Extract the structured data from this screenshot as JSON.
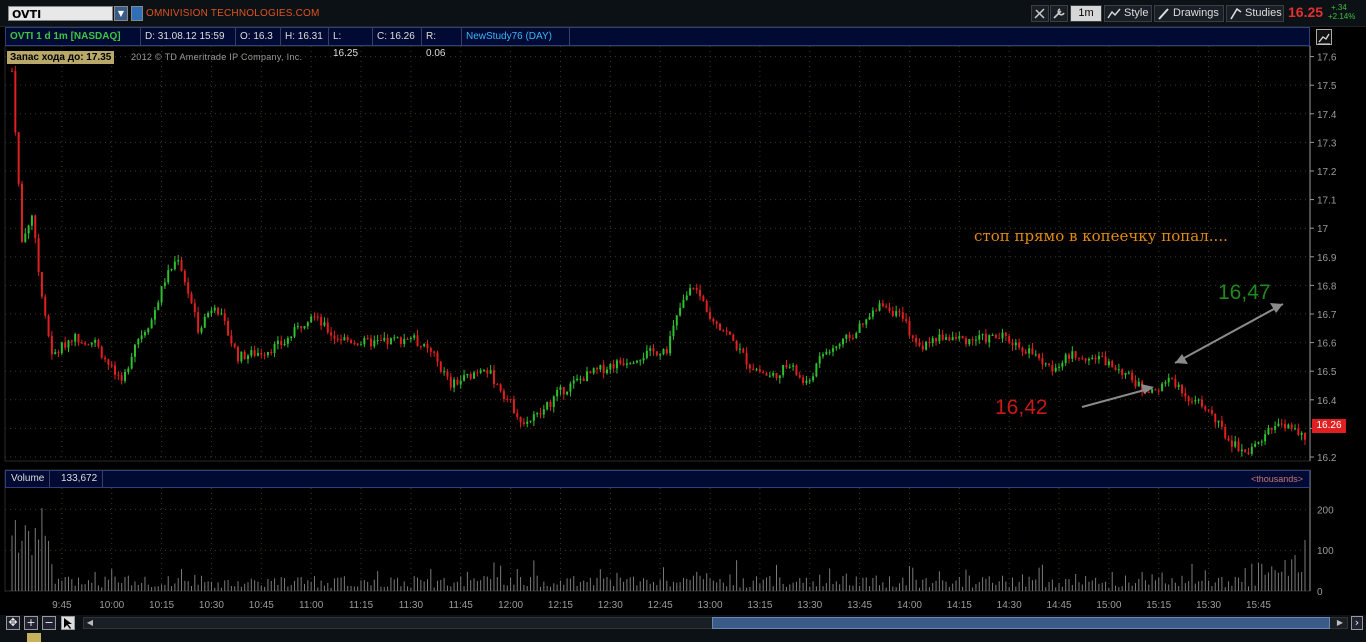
{
  "toolbar": {
    "symbol": "OVTI",
    "company": "OMNIVISION TECHNOLOGIES.COM",
    "aggregation": "1m",
    "style_label": "Style",
    "drawings_label": "Drawings",
    "studies_label": "Studies",
    "last_price": "16.25",
    "change_abs": "+.34",
    "change_pct": "+2.14%"
  },
  "info": {
    "title": "OVTI 1 d 1m [NASDAQ]",
    "date": "D: 31.08.12 15:59",
    "open": "O: 16.3",
    "high": "H: 16.31",
    "low": "L: 16.25",
    "close": "C: 16.26",
    "range": "R: 0.06",
    "study": "NewStudy76 (DAY)"
  },
  "badge": "Запас хода до: 17.35",
  "copyright": "2012 © TD Ameritrade IP Company, Inc.",
  "annotations": {
    "note": "стоп прямо в копеечку попал....",
    "green_price": "16,47",
    "red_price": "16,42"
  },
  "current_price_tag": "16.26",
  "volume": {
    "label": "Volume",
    "value": "133,672",
    "units": "<thousands>"
  },
  "colors": {
    "up": "#2fbf2f",
    "down": "#e02020",
    "grid": "#3a3a22",
    "axis": "#9a9a9a",
    "volume": "#7a7a7a"
  },
  "chart_data": {
    "type": "candlestick",
    "price_axis": {
      "ticks": [
        16.2,
        16.3,
        16.4,
        16.5,
        16.6,
        16.7,
        16.8,
        16.9,
        17,
        17.1,
        17.2,
        17.3,
        17.4,
        17.5,
        17.6
      ],
      "ylim": [
        16.18,
        17.63
      ]
    },
    "volume_axis": {
      "ticks": [
        0,
        100,
        200
      ]
    },
    "time_ticks": [
      "9:45",
      "10:00",
      "10:15",
      "10:30",
      "10:45",
      "11:00",
      "11:15",
      "11:30",
      "11:45",
      "12:00",
      "12:15",
      "12:30",
      "12:45",
      "13:00",
      "13:15",
      "13:30",
      "13:45",
      "14:00",
      "14:15",
      "14:30",
      "14:45",
      "15:00",
      "15:15",
      "15:30",
      "15:45"
    ],
    "price_path": [
      {
        "t": "9:30",
        "p": 17.55
      },
      {
        "t": "9:33",
        "p": 16.95
      },
      {
        "t": "9:36",
        "p": 17.05
      },
      {
        "t": "9:38",
        "p": 16.85
      },
      {
        "t": "9:42",
        "p": 16.55
      },
      {
        "t": "9:48",
        "p": 16.62
      },
      {
        "t": "9:55",
        "p": 16.6
      },
      {
        "t": "10:03",
        "p": 16.45
      },
      {
        "t": "10:07",
        "p": 16.6
      },
      {
        "t": "10:12",
        "p": 16.68
      },
      {
        "t": "10:16",
        "p": 16.82
      },
      {
        "t": "10:20",
        "p": 16.9
      },
      {
        "t": "10:26",
        "p": 16.65
      },
      {
        "t": "10:31",
        "p": 16.74
      },
      {
        "t": "10:38",
        "p": 16.55
      },
      {
        "t": "10:46",
        "p": 16.57
      },
      {
        "t": "10:52",
        "p": 16.6
      },
      {
        "t": "11:00",
        "p": 16.7
      },
      {
        "t": "11:07",
        "p": 16.62
      },
      {
        "t": "11:15",
        "p": 16.6
      },
      {
        "t": "11:22",
        "p": 16.6
      },
      {
        "t": "11:30",
        "p": 16.62
      },
      {
        "t": "11:37",
        "p": 16.55
      },
      {
        "t": "11:42",
        "p": 16.45
      },
      {
        "t": "11:47",
        "p": 16.48
      },
      {
        "t": "11:52",
        "p": 16.52
      },
      {
        "t": "11:58",
        "p": 16.42
      },
      {
        "t": "12:04",
        "p": 16.32
      },
      {
        "t": "12:09",
        "p": 16.35
      },
      {
        "t": "12:14",
        "p": 16.42
      },
      {
        "t": "12:22",
        "p": 16.48
      },
      {
        "t": "12:30",
        "p": 16.52
      },
      {
        "t": "12:38",
        "p": 16.55
      },
      {
        "t": "12:47",
        "p": 16.58
      },
      {
        "t": "12:51",
        "p": 16.72
      },
      {
        "t": "12:55",
        "p": 16.8
      },
      {
        "t": "13:00",
        "p": 16.7
      },
      {
        "t": "13:06",
        "p": 16.62
      },
      {
        "t": "13:12",
        "p": 16.52
      },
      {
        "t": "13:18",
        "p": 16.48
      },
      {
        "t": "13:24",
        "p": 16.52
      },
      {
        "t": "13:29",
        "p": 16.45
      },
      {
        "t": "13:34",
        "p": 16.56
      },
      {
        "t": "13:40",
        "p": 16.6
      },
      {
        "t": "13:46",
        "p": 16.66
      },
      {
        "t": "13:52",
        "p": 16.74
      },
      {
        "t": "13:58",
        "p": 16.68
      },
      {
        "t": "14:03",
        "p": 16.58
      },
      {
        "t": "14:09",
        "p": 16.62
      },
      {
        "t": "14:18",
        "p": 16.61
      },
      {
        "t": "14:28",
        "p": 16.62
      },
      {
        "t": "14:36",
        "p": 16.57
      },
      {
        "t": "14:42",
        "p": 16.51
      },
      {
        "t": "14:50",
        "p": 16.56
      },
      {
        "t": "14:58",
        "p": 16.54
      },
      {
        "t": "15:04",
        "p": 16.5
      },
      {
        "t": "15:10",
        "p": 16.44
      },
      {
        "t": "15:15",
        "p": 16.44
      },
      {
        "t": "15:19",
        "p": 16.47
      },
      {
        "t": "15:24",
        "p": 16.41
      },
      {
        "t": "15:30",
        "p": 16.36
      },
      {
        "t": "15:36",
        "p": 16.26
      },
      {
        "t": "15:41",
        "p": 16.22
      },
      {
        "t": "15:46",
        "p": 16.26
      },
      {
        "t": "15:51",
        "p": 16.32
      },
      {
        "t": "15:55",
        "p": 16.3
      },
      {
        "t": "15:59",
        "p": 16.26
      }
    ]
  }
}
